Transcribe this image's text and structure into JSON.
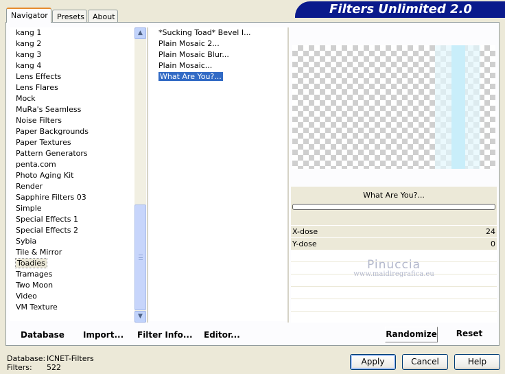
{
  "app": {
    "title": "Filters Unlimited 2.0"
  },
  "tabs": [
    {
      "label": "Navigator",
      "active": true
    },
    {
      "label": "Presets",
      "active": false
    },
    {
      "label": "About",
      "active": false
    }
  ],
  "categories": [
    "kang 1",
    "kang 2",
    "kang 3",
    "kang 4",
    "Lens Effects",
    "Lens Flares",
    "Mock",
    "MuRa's Seamless",
    "Noise Filters",
    "Paper Backgrounds",
    "Paper Textures",
    "Pattern Generators",
    "penta.com",
    "Photo Aging Kit",
    "Render",
    "Sapphire Filters 03",
    "Simple",
    "Special Effects 1",
    "Special Effects 2",
    "Sybia",
    "Tile & Mirror",
    "Toadies",
    "Tramages",
    "Two Moon",
    "Video",
    "VM Texture"
  ],
  "selected_category": "Toadies",
  "filters": [
    "*Sucking Toad*  Bevel I...",
    "Plain Mosaic 2...",
    "Plain Mosaic Blur...",
    "Plain Mosaic...",
    "What Are You?..."
  ],
  "selected_filter": "What Are You?...",
  "preview": {
    "filter_name": "What Are You?...",
    "progress": 0
  },
  "params": [
    {
      "label": "X-dose",
      "value": "24"
    },
    {
      "label": "Y-dose",
      "value": "0"
    }
  ],
  "watermark": {
    "line1": "Pinuccia",
    "line2": "www.maidiregrafica.eu"
  },
  "toolbar": {
    "database": "Database",
    "import": "Import...",
    "filter_info": "Filter Info...",
    "editor": "Editor...",
    "randomize": "Randomize",
    "reset": "Reset"
  },
  "status": {
    "database_label": "Database:",
    "database_value": "ICNET-Filters",
    "filters_label": "Filters:",
    "filters_value": "522"
  },
  "buttons": {
    "apply": "Apply",
    "cancel": "Cancel",
    "help": "Help"
  },
  "colors": {
    "banner": "#0a1a8c",
    "selection": "#316ac5",
    "preview_stripe": "#c9eefa"
  }
}
